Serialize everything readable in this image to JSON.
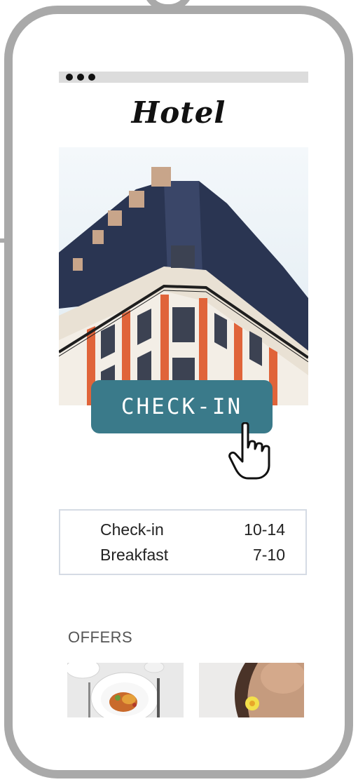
{
  "app": {
    "title": "Hotel"
  },
  "hero": {
    "image": "hotel-building-photo"
  },
  "checkin_button": {
    "label": "CHECK-IN",
    "icon": "pointer-hand-icon"
  },
  "info": {
    "rows": [
      {
        "label": "Check-in",
        "value": "10-14"
      },
      {
        "label": "Breakfast",
        "value": "7-10"
      }
    ]
  },
  "offers": {
    "title": "OFFERS",
    "items": [
      {
        "image": "restaurant-plate-photo"
      },
      {
        "image": "spa-woman-flower-photo"
      }
    ]
  },
  "colors": {
    "frame": "#a9a9a9",
    "accent": "#3a7a8a",
    "status_bar": "#dcdcdc"
  }
}
